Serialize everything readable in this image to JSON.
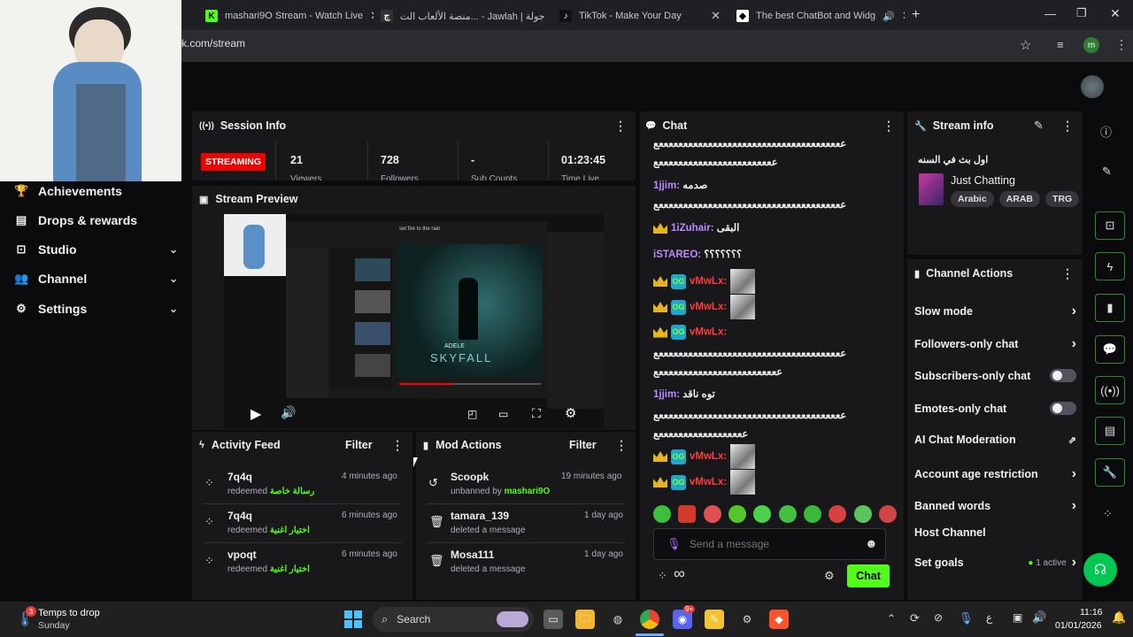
{
  "browser": {
    "tabs": [
      {
        "title": "mashari9O Stream - Watch Live"
      },
      {
        "title": "منصة الألعاب الت... - Jawlah | جولة"
      },
      {
        "title": "TikTok - Make Your Day"
      },
      {
        "title": "The best ChatBot and Widg"
      }
    ],
    "url": "k.com/stream",
    "new_tab": "+",
    "profile_initial": "m"
  },
  "sidebar": {
    "items": [
      {
        "label": "Achievements",
        "icon": "trophy-icon"
      },
      {
        "label": "Drops & rewards",
        "icon": "gift-icon"
      },
      {
        "label": "Studio",
        "icon": "studio-icon"
      },
      {
        "label": "Channel",
        "icon": "users-icon"
      },
      {
        "label": "Settings",
        "icon": "gear-icon"
      }
    ]
  },
  "session": {
    "title": "Session Info",
    "status": "STREAMING",
    "viewers": "21",
    "viewers_label": "Viewers",
    "followers": "728",
    "followers_label": "Followers",
    "sub_counts": "-",
    "sub_counts_label": "Sub Counts",
    "time_live": "01:23:45",
    "time_live_label": "Time Live"
  },
  "preview": {
    "title": "Stream Preview",
    "video_title": "SKYFALL",
    "video_artist": "ADELE",
    "caption": "set fire to the rain"
  },
  "activity": {
    "title": "Activity Feed",
    "filter": "Filter",
    "items": [
      {
        "user": "7q4q",
        "action": "redeemed",
        "reward": "رسالة خاصة",
        "time": "4 minutes ago"
      },
      {
        "user": "7q4q",
        "action": "redeemed",
        "reward": "اختيار اغنية",
        "time": "6 minutes ago"
      },
      {
        "user": "vpoqt",
        "action": "redeemed",
        "reward": "اختيار اغنية",
        "time": "6 minutes ago"
      }
    ]
  },
  "mod": {
    "title": "Mod Actions",
    "filter": "Filter",
    "items": [
      {
        "user": "Scoopk",
        "action": "unbanned by",
        "by": "mashari9O",
        "time": "19 minutes ago"
      },
      {
        "user": "tamara_139",
        "action": "deleted a message",
        "by": "",
        "time": "1 day ago"
      },
      {
        "user": "Mosa111",
        "action": "deleted a message",
        "by": "",
        "time": "1 day ago"
      }
    ]
  },
  "chat": {
    "title": "Chat",
    "lines": [
      {
        "text": "ععععععععععععععععععععععععععععععععععععععع"
      },
      {
        "text": "ععععععععععععععععععععععععع"
      },
      {
        "user": "1jjim:",
        "msg": "صدمه"
      },
      {
        "text": "ععععععععععععععععععععععععععععععععععععععع"
      },
      {
        "user": "1iZuhair:",
        "msg": "البقى"
      },
      {
        "user": "iSTAREO:",
        "msg": "؟؟؟؟؟؟؟"
      },
      {
        "user": "vMwLx:"
      },
      {
        "user": "vMwLx:"
      },
      {
        "user": "vMwLx:"
      },
      {
        "text": "ععععععععععععععععععععععععععععععععععععععع"
      },
      {
        "text": "عععععععععععععععععععععععععع"
      },
      {
        "user": "1jjim:",
        "msg": "توه ناقد"
      },
      {
        "text": "ععععععععععععععععععععععععععععععععععععععع"
      },
      {
        "text": "ععععععععععععععععععع"
      },
      {
        "user": "vMwLx:"
      },
      {
        "user": "vMwLx:"
      }
    ],
    "input_placeholder": "Send a message",
    "send_label": "Chat",
    "infinity": "∞"
  },
  "stream_info": {
    "title": "Stream info",
    "stream_title": "اول بث في السنه",
    "category": "Just Chatting",
    "tags": [
      "Arabic",
      "ARAB",
      "TRG"
    ]
  },
  "channel_actions": {
    "title": "Channel Actions",
    "items": [
      {
        "label": "Slow mode",
        "control": "chevron"
      },
      {
        "label": "Followers-only chat",
        "control": "chevron"
      },
      {
        "label": "Subscribers-only chat",
        "control": "toggle"
      },
      {
        "label": "Emotes-only chat",
        "control": "toggle"
      },
      {
        "label": "AI Chat Moderation",
        "control": "external"
      },
      {
        "label": "Account age restriction",
        "control": "chevron"
      },
      {
        "label": "Banned words",
        "control": "chevron"
      },
      {
        "label": "Host Channel",
        "control": "none"
      },
      {
        "label": "Set goals",
        "control": "chevron"
      }
    ],
    "goals_active": "1 active"
  },
  "taskbar": {
    "weather_title": "Temps to drop",
    "weather_sub": "Sunday",
    "weather_badge": "3",
    "search": "Search",
    "lang": "ع",
    "time": "11:16",
    "date": "01/01/2026",
    "discord_badge": "9+"
  },
  "colors": {
    "accent": "#53fc18",
    "streaming": "#eb0400"
  }
}
